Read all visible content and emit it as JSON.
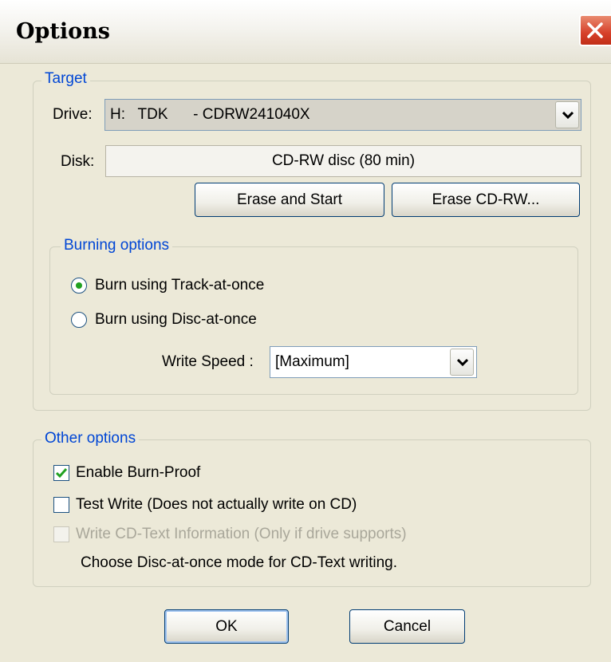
{
  "window": {
    "title": "Options",
    "close_icon": "close-icon"
  },
  "target": {
    "legend": "Target",
    "drive_label": "Drive:",
    "drive_value": "H:   TDK      - CDRW241040X",
    "disk_label": "Disk:",
    "disk_value": "CD-RW disc (80 min)",
    "erase_start_label": "Erase and Start",
    "erase_cdrw_label": "Erase CD-RW..."
  },
  "burning": {
    "legend": "Burning options",
    "track_at_once_label": "Burn using Track-at-once",
    "track_at_once_selected": true,
    "disc_at_once_label": "Burn using Disc-at-once",
    "disc_at_once_selected": false,
    "write_speed_label": "Write Speed :",
    "write_speed_value": "[Maximum]"
  },
  "other": {
    "legend": "Other options",
    "burn_proof_label": "Enable Burn-Proof",
    "burn_proof_checked": true,
    "test_write_label": "Test Write (Does not actually write on CD)",
    "test_write_checked": false,
    "cd_text_label": "Write CD-Text Information (Only if drive supports)",
    "cd_text_checked": false,
    "cd_text_note": "Choose Disc-at-once mode for CD-Text writing."
  },
  "buttons": {
    "ok_label": "OK",
    "cancel_label": "Cancel"
  },
  "colors": {
    "legend": "#0046d5",
    "accent_check": "#21a121",
    "close": "#d6402a"
  }
}
